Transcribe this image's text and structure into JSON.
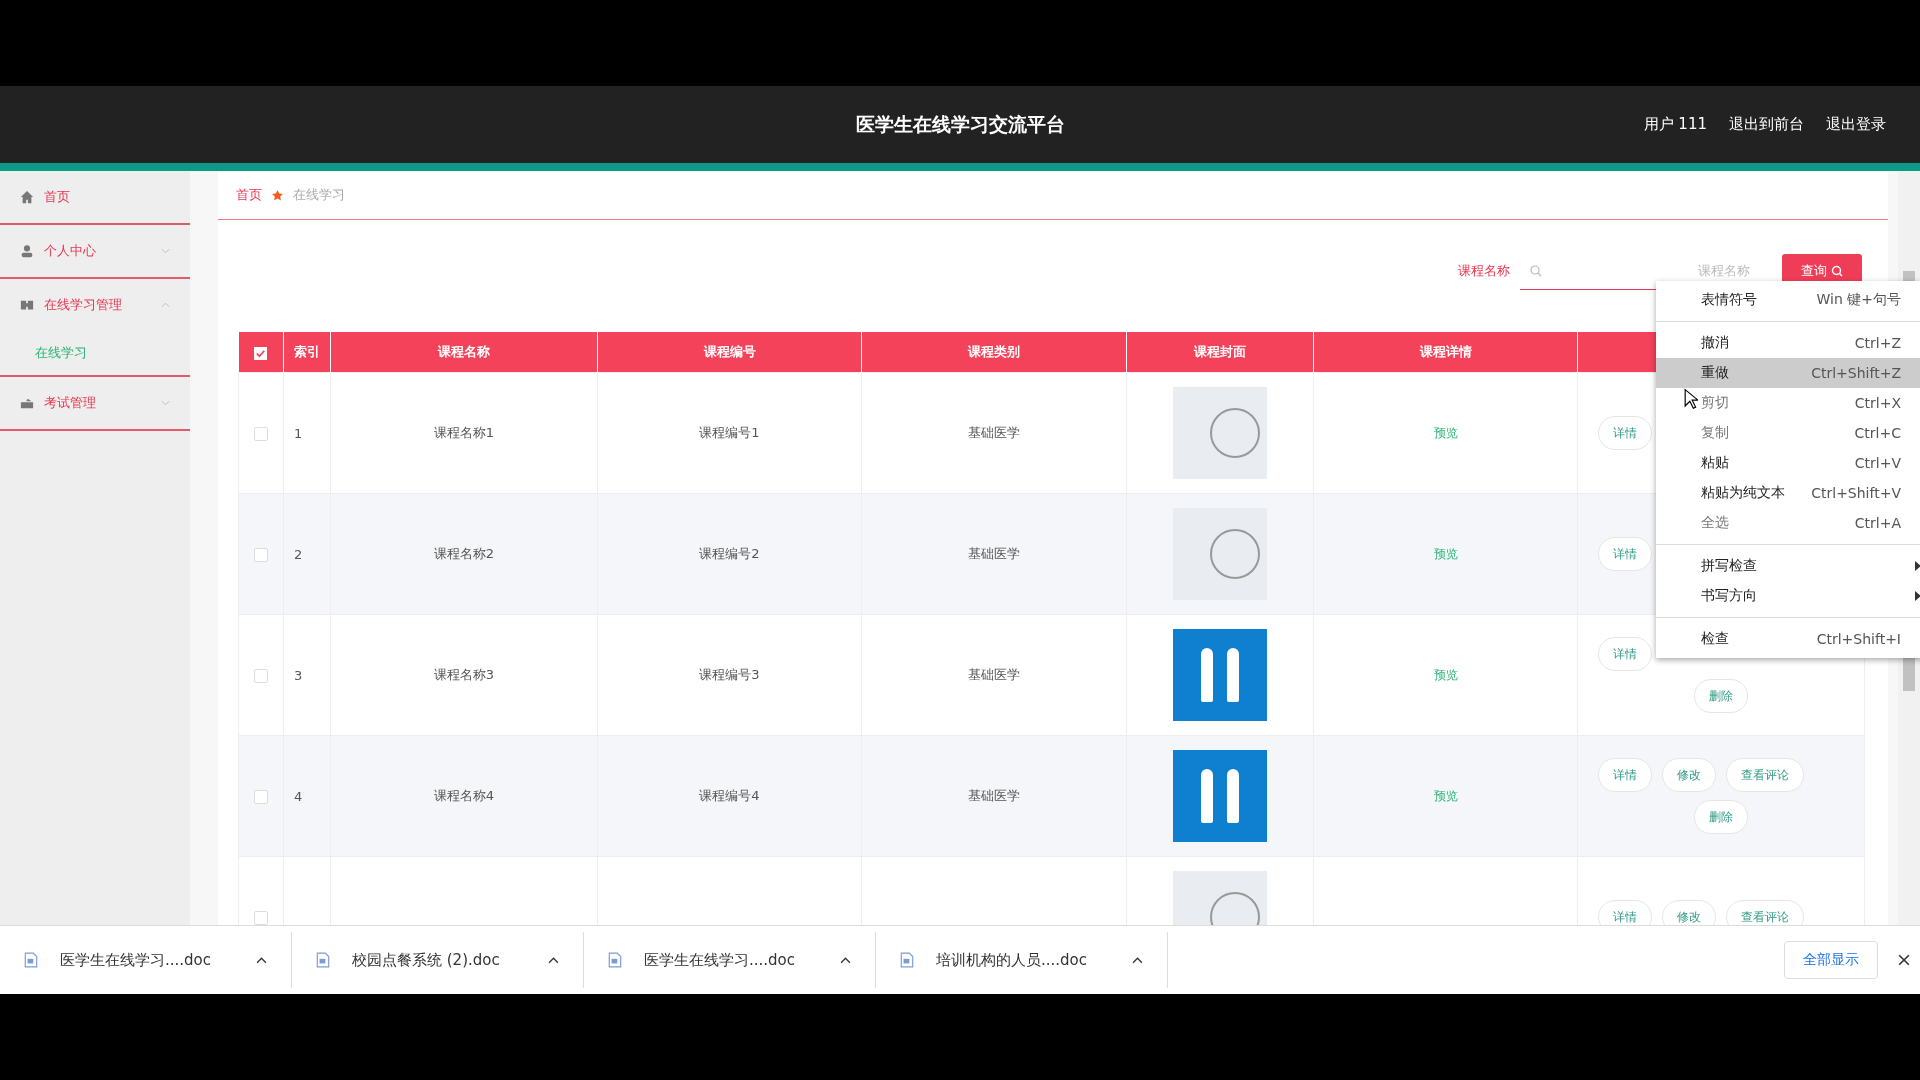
{
  "header": {
    "title": "医学生在线学习交流平台",
    "links": [
      "用户 111",
      "退出到前台",
      "退出登录"
    ]
  },
  "sidebar": {
    "items": [
      {
        "label": "首页"
      },
      {
        "label": "个人中心",
        "expanded": false
      },
      {
        "label": "在线学习管理",
        "expanded": true,
        "children": [
          {
            "label": "在线学习",
            "selected": true
          }
        ]
      },
      {
        "label": "考试管理",
        "expanded": false
      }
    ]
  },
  "breadcrumb": [
    "首页",
    "在线学习"
  ],
  "search": {
    "label": "课程名称",
    "placeholder": "课程名称",
    "button": "查询"
  },
  "table": {
    "header_checked": true,
    "columns": [
      "索引",
      "课程名称",
      "课程编号",
      "课程类别",
      "课程封面",
      "课程详情"
    ],
    "rows": [
      {
        "kind": "sketch",
        "checked": false,
        "index": "1",
        "name": "课程名称1",
        "code": "课程编号1",
        "category": "基础医学",
        "detail": "预览",
        "actions": [
          [
            "详情"
          ]
        ]
      },
      {
        "kind": "sketch",
        "checked": false,
        "index": "2",
        "name": "课程名称2",
        "code": "课程编号2",
        "category": "基础医学",
        "detail": "预览",
        "actions": [
          [
            "详情"
          ]
        ]
      },
      {
        "kind": "poster",
        "checked": false,
        "index": "3",
        "name": "课程名称3",
        "code": "课程编号3",
        "category": "基础医学",
        "detail": "预览",
        "actions": [
          [
            "详情"
          ],
          [
            "删除"
          ]
        ]
      },
      {
        "kind": "poster",
        "checked": false,
        "index": "4",
        "name": "课程名称4",
        "code": "课程编号4",
        "category": "基础医学",
        "detail": "预览",
        "actions": [
          [
            "详情",
            "修改",
            "查看评论"
          ],
          [
            "删除"
          ]
        ]
      },
      {
        "kind": "sketch",
        "checked": false,
        "actions": [
          [
            "详情",
            "修改",
            "查看评论"
          ]
        ]
      }
    ]
  },
  "context_menu": {
    "groups": [
      [
        {
          "label": "表情符号",
          "shortcut": "Win 键+句号",
          "disabled": false,
          "selected": false,
          "submenu": false
        }
      ],
      [
        {
          "label": "撤消",
          "shortcut": "Ctrl+Z",
          "disabled": false,
          "selected": false,
          "submenu": false
        },
        {
          "label": "重做",
          "shortcut": "Ctrl+Shift+Z",
          "disabled": false,
          "selected": true,
          "submenu": false
        },
        {
          "label": "剪切",
          "shortcut": "Ctrl+X",
          "disabled": true,
          "selected": false,
          "submenu": false
        },
        {
          "label": "复制",
          "shortcut": "Ctrl+C",
          "disabled": true,
          "selected": false,
          "submenu": false
        },
        {
          "label": "粘贴",
          "shortcut": "Ctrl+V",
          "disabled": false,
          "selected": false,
          "submenu": false
        },
        {
          "label": "粘贴为纯文本",
          "shortcut": "Ctrl+Shift+V",
          "disabled": false,
          "selected": false,
          "submenu": false
        },
        {
          "label": "全选",
          "shortcut": "Ctrl+A",
          "disabled": true,
          "selected": false,
          "submenu": false
        }
      ],
      [
        {
          "label": "拼写检查",
          "disabled": false,
          "selected": false,
          "submenu": true
        },
        {
          "label": "书写方向",
          "disabled": false,
          "selected": false,
          "submenu": true
        }
      ],
      [
        {
          "label": "检查",
          "shortcut": "Ctrl+Shift+I",
          "disabled": false,
          "selected": false,
          "submenu": false
        }
      ]
    ]
  },
  "downloads": {
    "files": [
      "医学生在线学习....doc",
      "校园点餐系统 (2).doc",
      "医学生在线学习....doc",
      "培训机构的人员....doc"
    ],
    "show_all": "全部显示"
  }
}
